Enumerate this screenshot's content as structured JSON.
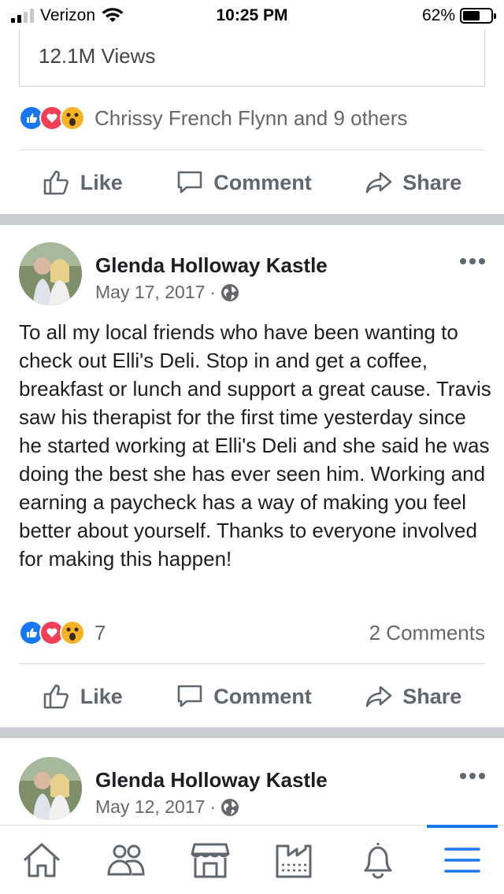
{
  "status_bar": {
    "carrier": "Verizon",
    "time": "10:25 PM",
    "battery_text": "62%",
    "battery_level": 0.62
  },
  "previous_post": {
    "views": "12.1M Views",
    "reactions_text": "Chrissy French Flynn and 9 others",
    "reaction_icons": [
      "like-icon",
      "love-icon",
      "wow-icon"
    ]
  },
  "actions": {
    "like": "Like",
    "comment": "Comment",
    "share": "Share"
  },
  "post1": {
    "author": "Glenda Holloway Kastle",
    "date": "May 17, 2017",
    "separator": "·",
    "text": "To all my local friends who have been wanting to check out Elli's Deli.  Stop in and get a coffee, breakfast or lunch and support a great cause.  Travis saw his therapist for the first time yesterday since he started working at Elli's Deli and she said he was doing the best she has ever seen him.  Working and earning a paycheck has a way of making you feel better about yourself.  Thanks to everyone involved for making this happen!",
    "reaction_count": "7",
    "comments_count": "2 Comments"
  },
  "post2": {
    "author": "Glenda Holloway Kastle",
    "date": "May 12, 2017",
    "separator": "·"
  },
  "bottom_nav": [
    "home-icon",
    "friends-icon",
    "marketplace-icon",
    "pages-icon",
    "notifications-icon",
    "menu-icon"
  ],
  "colors": {
    "accent": "#1877f2",
    "love": "#f33e58",
    "wow": "#f7b125",
    "separator": "#c9ccd1"
  }
}
